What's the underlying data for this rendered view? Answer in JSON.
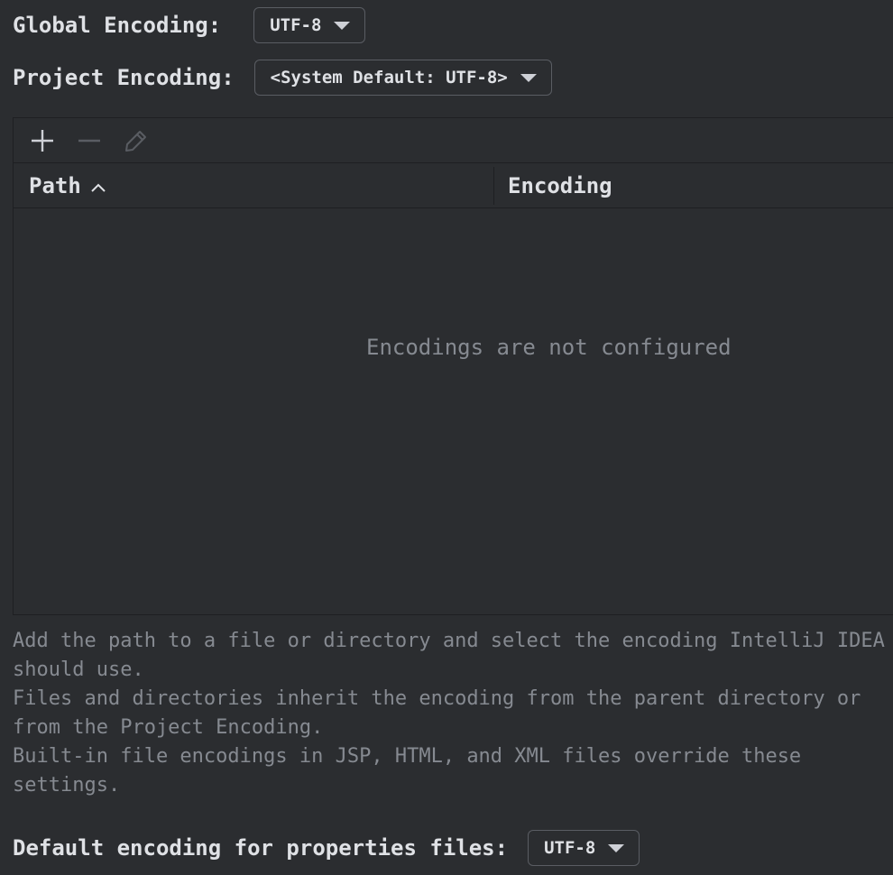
{
  "global_encoding": {
    "label": "Global Encoding:",
    "value": "UTF-8"
  },
  "project_encoding": {
    "label": "Project Encoding:",
    "value": "<System Default: UTF-8>"
  },
  "toolbar": {
    "add_icon": "plus-icon",
    "remove_icon": "minus-icon",
    "edit_icon": "pencil-icon"
  },
  "table": {
    "columns": [
      "Path",
      "Encoding"
    ],
    "sort_icon": "chevron-up-icon",
    "empty_text": "Encodings are not configured"
  },
  "help": {
    "lines": [
      "Add the path to a file or directory and select the encoding IntelliJ IDEA should use.",
      "Files and directories inherit the encoding from the parent directory or from the Project Encoding.",
      "Built-in file encodings in JSP, HTML, and XML files override these settings."
    ]
  },
  "properties_encoding": {
    "label": "Default encoding for properties files:",
    "value": "UTF-8"
  },
  "colors": {
    "background": "#2b2d30",
    "border": "#1e1f22",
    "text": "#dfe1e5",
    "muted_text": "#868a91"
  }
}
